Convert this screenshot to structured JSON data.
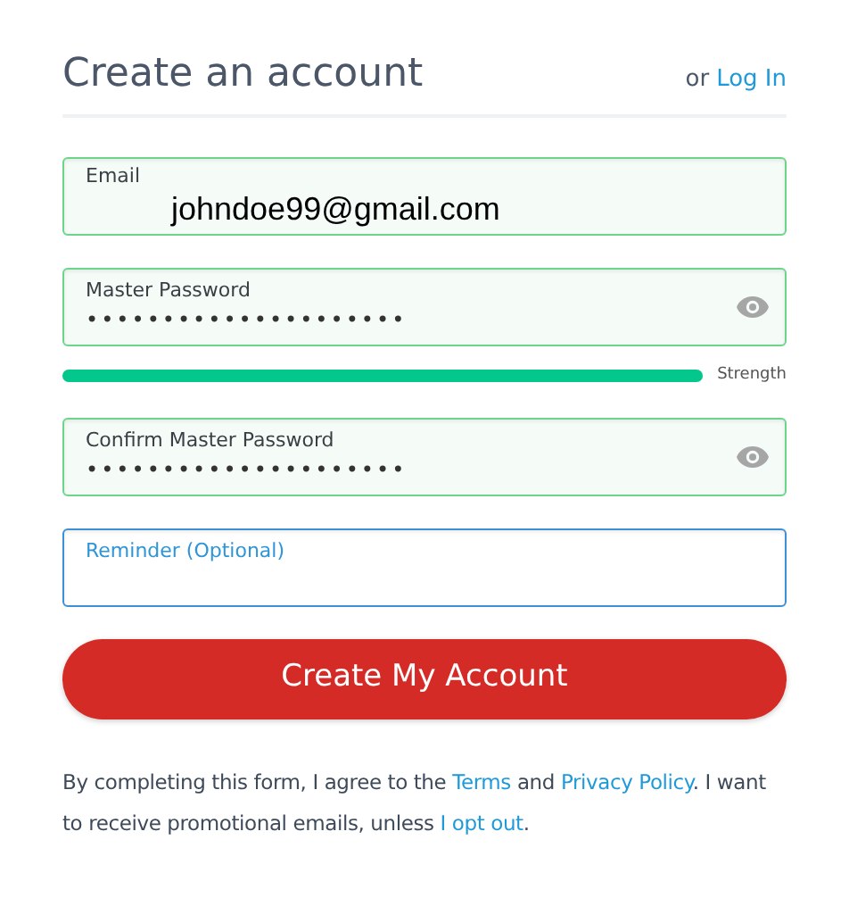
{
  "header": {
    "title": "Create an account",
    "login_prefix": "or",
    "login_link": "Log In"
  },
  "fields": [
    {
      "kind": "email",
      "label": "Email",
      "value": "johndoe99@gmail.com",
      "focused": false,
      "valid": true
    },
    {
      "kind": "password",
      "label": "Master Password",
      "value": "•••••••••••••••••••••",
      "focused": false,
      "valid": true,
      "strength": {
        "level": 1,
        "label": "Strength"
      }
    },
    {
      "kind": "password",
      "label": "Confirm Master Password",
      "value": "•••••••••••••••••••••",
      "focused": false,
      "valid": true
    },
    {
      "kind": "text",
      "label": "Reminder (Optional)",
      "focused": true,
      "valid": false
    }
  ],
  "submit": "Create My Account",
  "terms": [
    {
      "kind": "text",
      "text": "By completing this form, I agree to the "
    },
    {
      "kind": "link",
      "text": "Terms"
    },
    {
      "kind": "text",
      "text": " and "
    },
    {
      "kind": "link",
      "text": "Privacy Policy"
    },
    {
      "kind": "text",
      "text": ". I want to receive promotional emails, unless "
    },
    {
      "kind": "link",
      "text": "I opt out"
    },
    {
      "kind": "text",
      "text": "."
    }
  ]
}
